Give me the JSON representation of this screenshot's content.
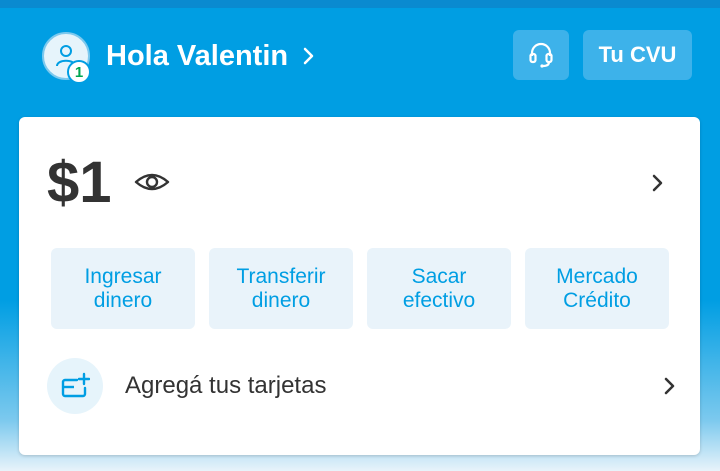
{
  "header": {
    "greeting": "Hola Valentin",
    "notification_count": "1",
    "cvu_label": "Tu CVU"
  },
  "account": {
    "balance": "$1"
  },
  "actions": [
    {
      "label": "Ingresar\ndinero"
    },
    {
      "label": "Transferir\ndinero"
    },
    {
      "label": "Sacar\nefectivo"
    },
    {
      "label": "Mercado\nCrédito"
    }
  ],
  "cards_row": {
    "label": "Agregá tus tarjetas"
  },
  "colors": {
    "brand_blue": "#009ee3",
    "button_blue": "#3db2ea",
    "action_bg": "#e9f3fa",
    "badge_green": "#00a650"
  }
}
